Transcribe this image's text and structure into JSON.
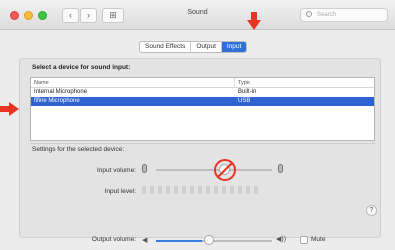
{
  "window": {
    "title": "Sound",
    "search_placeholder": "Search",
    "nav": {
      "back": "‹",
      "forward": "›",
      "grid": "⊞"
    }
  },
  "tabs": [
    {
      "label": "Sound Effects"
    },
    {
      "label": "Output"
    },
    {
      "label": "Input",
      "selected": true
    }
  ],
  "input": {
    "section_title": "Select a device for sound input:",
    "columns": [
      "Name",
      "Type"
    ],
    "devices": [
      {
        "name": "Internal Microphone",
        "type": "Built-in"
      },
      {
        "name": "fifine Microphone",
        "type": "USB",
        "selected": true
      }
    ],
    "settings_label": "Settings for the selected device:",
    "input_volume_label": "Input volume:",
    "input_level_label": "Input level:",
    "input_level_segments": 15,
    "help": "?"
  },
  "output": {
    "volume_label": "Output volume:",
    "volume_level": 0.4,
    "mute_label": "Mute",
    "muted": false
  },
  "colors": {
    "accent": "#2f6fd8",
    "annotation_red": "#e83423"
  },
  "icons": {
    "close": "traffic-close",
    "minimize": "traffic-min",
    "maximize": "traffic-max",
    "prohibit": "prohibit-icon"
  }
}
